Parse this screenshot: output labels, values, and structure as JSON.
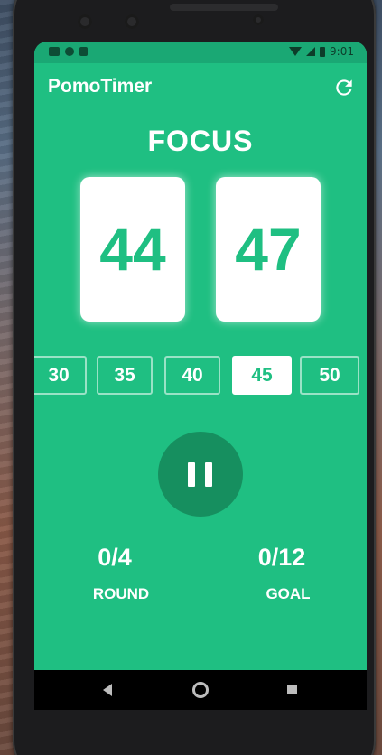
{
  "colors": {
    "primary": "#1fbf82",
    "status_bar": "#1aa874",
    "pause_button": "#168f5f",
    "text": "#ffffff"
  },
  "status_bar": {
    "time": "9:01",
    "icons": [
      "gmail-icon",
      "circle-icon",
      "sd-card-icon",
      "wifi-icon",
      "signal-icon",
      "battery-icon"
    ]
  },
  "app_bar": {
    "title": "PomoTimer",
    "action_icon": "refresh-icon"
  },
  "timer": {
    "mode": "FOCUS",
    "minutes": "44",
    "seconds": "47"
  },
  "durations": {
    "options": [
      "30",
      "35",
      "40",
      "45",
      "50"
    ],
    "selected": "45"
  },
  "controls": {
    "play_pause_icon": "pause-icon"
  },
  "stats": {
    "round_value": "0/4",
    "round_label": "ROUND",
    "goal_value": "0/12",
    "goal_label": "GOAL"
  },
  "system_nav": {
    "icons": [
      "back-icon",
      "home-icon",
      "recent-apps-icon"
    ]
  }
}
